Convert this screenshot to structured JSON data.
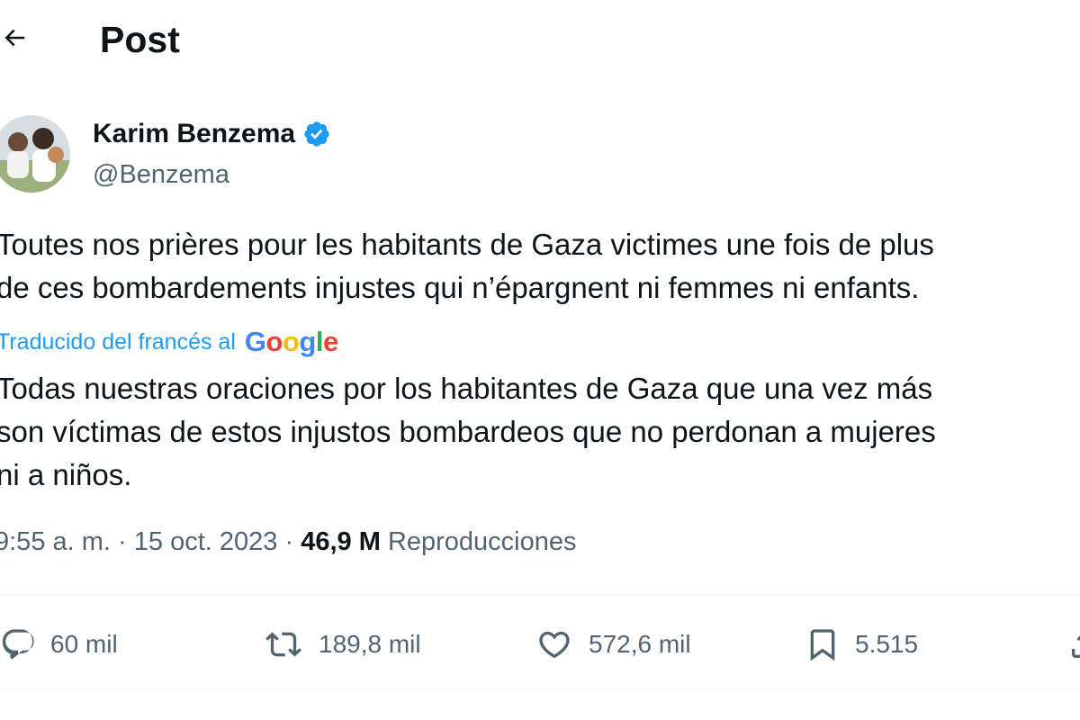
{
  "header": {
    "back_icon": "arrow-left-icon",
    "title": "Post"
  },
  "author": {
    "name": "Karim Benzema",
    "handle": "@Benzema",
    "verified_icon": "verified-badge-icon",
    "verified_color": "#1d9bf0"
  },
  "tweet": {
    "original_text": "Toutes nos prières pour les habitants de Gaza victimes une fois de plus\nde ces bombardements injustes qui n’épargnent ni femmes ni enfants.",
    "translation_label": "Traducido del francés al",
    "translation_provider": "Google",
    "translated_text": "Todas nuestras oraciones por los habitantes de Gaza que una vez más\nson víctimas de estos injustos bombardeos que no perdonan a mujeres\nni a niños."
  },
  "meta": {
    "time": "9:55 a. m.",
    "separator": "·",
    "date": "15 oct. 2023",
    "views_count": "46,9 M",
    "views_label": "Reproducciones"
  },
  "actions": {
    "replies": "60 mil",
    "reposts": "189,8 mil",
    "likes": "572,6 mil",
    "bookmarks": "5.515"
  },
  "colors": {
    "accent": "#1d9bf0",
    "text": "#0f1419",
    "secondary": "#536471"
  }
}
